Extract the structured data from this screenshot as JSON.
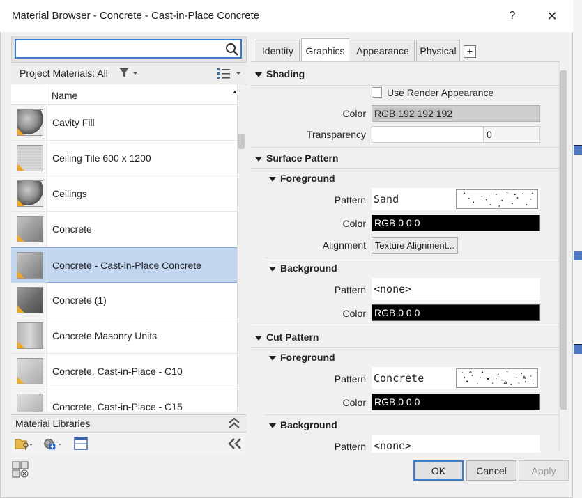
{
  "window": {
    "title": "Material Browser - Concrete - Cast-in-Place Concrete",
    "help": "?",
    "close": "✕"
  },
  "search": {
    "value": "",
    "placeholder": ""
  },
  "project_materials": {
    "label": "Project Materials: All"
  },
  "list": {
    "column_name": "Name",
    "items": [
      {
        "name": "Cavity Fill",
        "thumb": "sphere-grey"
      },
      {
        "name": "Ceiling Tile 600 x 1200",
        "thumb": "tile-light"
      },
      {
        "name": "Ceilings",
        "thumb": "sphere-grey"
      },
      {
        "name": "Concrete",
        "thumb": "cube-grey"
      },
      {
        "name": "Concrete - Cast-in-Place Concrete",
        "thumb": "cube-grey",
        "selected": true
      },
      {
        "name": "Concrete (1)",
        "thumb": "cube-dark"
      },
      {
        "name": "Concrete Masonry Units",
        "thumb": "block-grey"
      },
      {
        "name": "Concrete, Cast-in-Place - C10",
        "thumb": "cube-light"
      },
      {
        "name": "Concrete, Cast-in-Place - C15",
        "thumb": "cube-light"
      }
    ]
  },
  "libraries": {
    "label": "Material Libraries"
  },
  "tabs": [
    "Identity",
    "Graphics",
    "Appearance",
    "Physical"
  ],
  "tab_add": "+",
  "active_tab": "Graphics",
  "graphics": {
    "shading": {
      "header": "Shading",
      "use_render_label": "Use Render Appearance",
      "color_label": "Color",
      "color_value": "RGB 192 192 192",
      "transparency_label": "Transparency",
      "transparency_value": "0"
    },
    "surface": {
      "header": "Surface Pattern",
      "fg_header": "Foreground",
      "fg_pattern_label": "Pattern",
      "fg_pattern_value": "Sand",
      "fg_color_label": "Color",
      "fg_color_value": "RGB 0 0 0",
      "alignment_label": "Alignment",
      "alignment_button": "Texture Alignment...",
      "bg_header": "Background",
      "bg_pattern_label": "Pattern",
      "bg_pattern_value": "<none>",
      "bg_color_label": "Color",
      "bg_color_value": "RGB 0 0 0"
    },
    "cut": {
      "header": "Cut Pattern",
      "fg_header": "Foreground",
      "fg_pattern_label": "Pattern",
      "fg_pattern_value": "Concrete",
      "fg_color_label": "Color",
      "fg_color_value": "RGB 0 0 0",
      "bg_header": "Background",
      "bg_pattern_label": "Pattern",
      "bg_pattern_value": "<none>"
    }
  },
  "buttons": {
    "ok": "OK",
    "cancel": "Cancel",
    "apply": "Apply"
  },
  "colors": {
    "accent": "#3b7ad0",
    "selection": "#c2d6ef",
    "warning": "#f2a81d"
  }
}
